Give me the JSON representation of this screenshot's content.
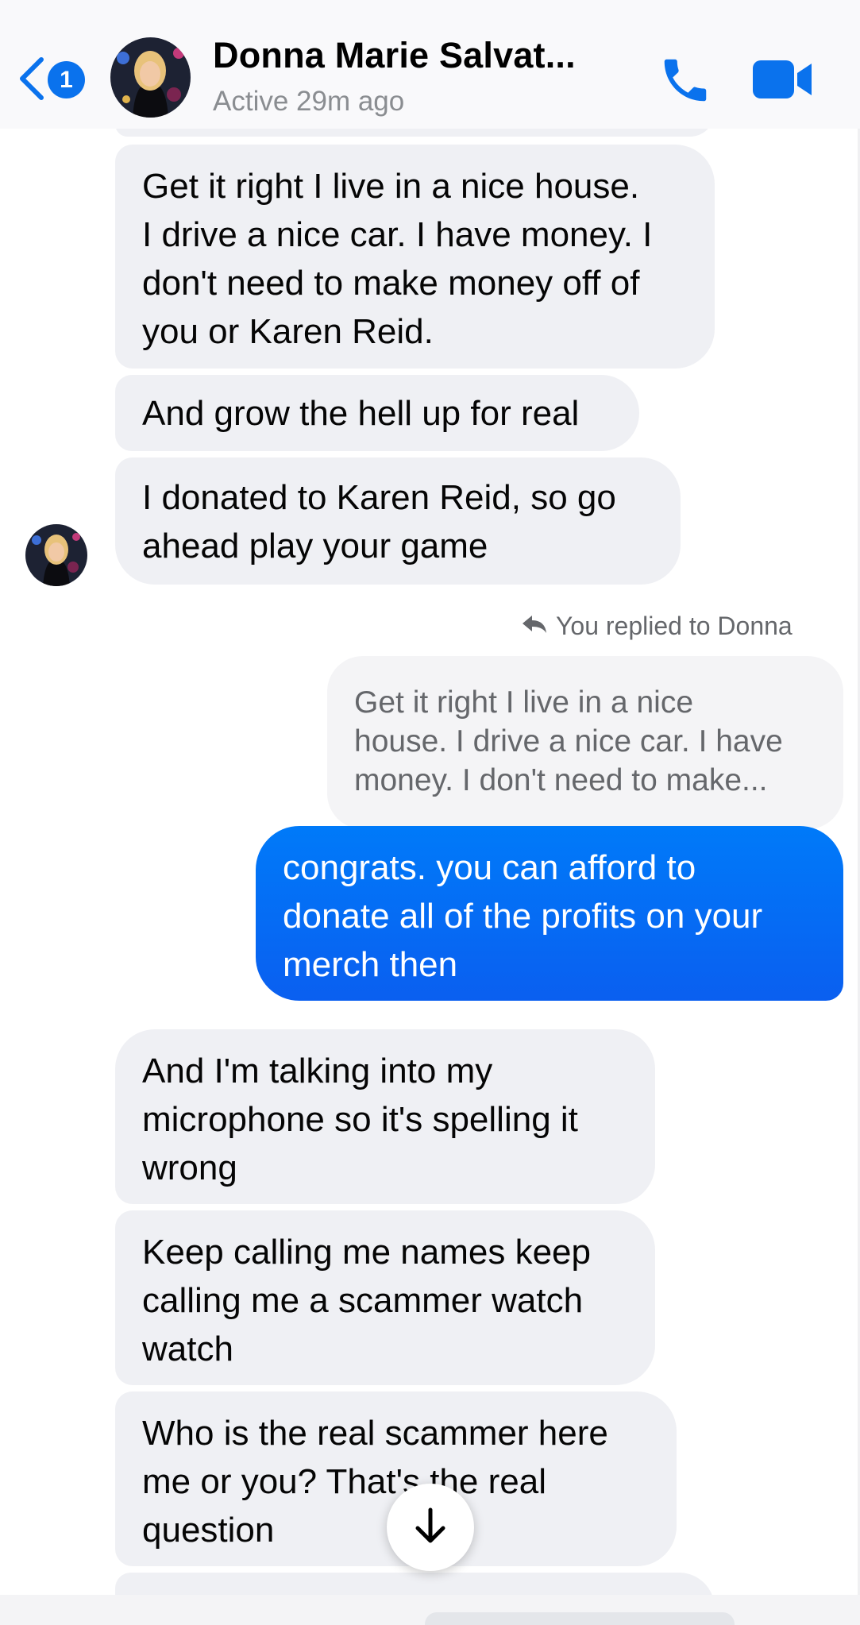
{
  "colors": {
    "accent": "#0a72ed",
    "sent_bubble": "#0a66f5",
    "received_bubble": "#eff0f4",
    "secondary_text": "#65676b"
  },
  "header": {
    "back_badge_count": "1",
    "contact_name": "Donna Marie Salvat...",
    "status": "Active 29m ago",
    "icons": {
      "back": "chevron-left-icon",
      "call": "phone-icon",
      "video": "video-camera-icon"
    }
  },
  "messages": [
    {
      "from": "contact",
      "text": ""
    },
    {
      "from": "contact",
      "text": "Get it right I live in a nice house.\nI drive a nice car. I have money. I\ndon't need to make money off of\nyou or Karen Reid."
    },
    {
      "from": "contact",
      "text": "And grow the hell up for real"
    },
    {
      "from": "contact",
      "text": "I donated to Karen Reid, so go\nahead play your game"
    },
    {
      "from": "me",
      "reply_label": "You replied to Donna",
      "quoted_text": "Get it right I live in a nice\nhouse. I drive a nice car. I have\nmoney. I don't need to make...",
      "text": "congrats. you can afford to\ndonate all of the profits on your\nmerch then"
    },
    {
      "from": "contact",
      "text": "And I'm talking into my\nmicrophone so it's spelling it\nwrong"
    },
    {
      "from": "contact",
      "text": "Keep calling me names keep\ncalling me a scammer watch\nwatch"
    },
    {
      "from": "contact",
      "text": "Who is the real scammer here\nme or you? That's the real\nquestion"
    },
    {
      "from": "contact",
      "text": ""
    }
  ],
  "scroll_to_bottom_icon": "arrow-down-icon",
  "reply_icon": "reply-arrow-icon"
}
